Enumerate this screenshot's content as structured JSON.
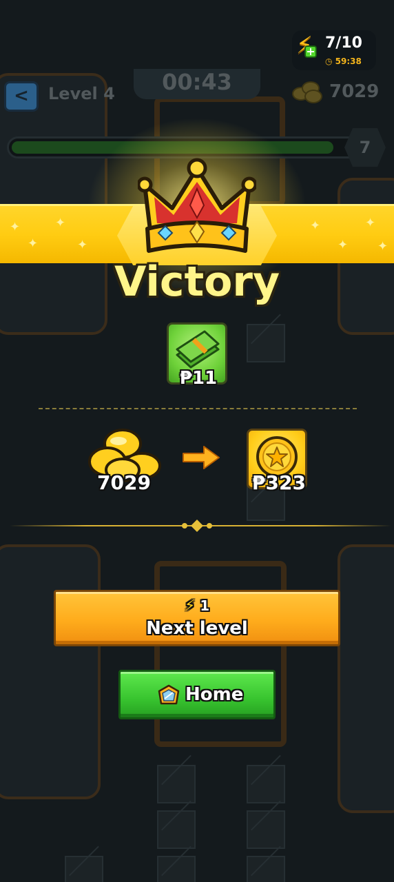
{
  "hud": {
    "energy_count": "7/10",
    "energy_timer": "59:38",
    "plus_symbol": "+"
  },
  "game_header": {
    "back_symbol": "<",
    "level_label": "Level 4",
    "timer": "00:43",
    "coin_balance": "7029",
    "progress_level": "7",
    "progress_fraction": 0.92
  },
  "victory": {
    "title": "Victory"
  },
  "rewards": {
    "cash_value": "₱11",
    "coins_before": "7029",
    "coin_reward": "₱323"
  },
  "buttons": {
    "next_cost": "1",
    "next_label": "Next level",
    "home_label": "Home"
  },
  "icons": {
    "energy": "lightning-bolt-icon",
    "cash": "cash-stack-icon",
    "coins": "coin-pile-icon",
    "coin": "star-coin-icon",
    "arrow": "arrow-right-icon",
    "crown": "crown-icon",
    "home": "home-shield-icon"
  },
  "colors": {
    "background": "#141a1d",
    "ribbon": "#ffcc12",
    "victory_text": "#fff58a",
    "next_button": "#ffac1c",
    "home_button": "#38c42f"
  }
}
